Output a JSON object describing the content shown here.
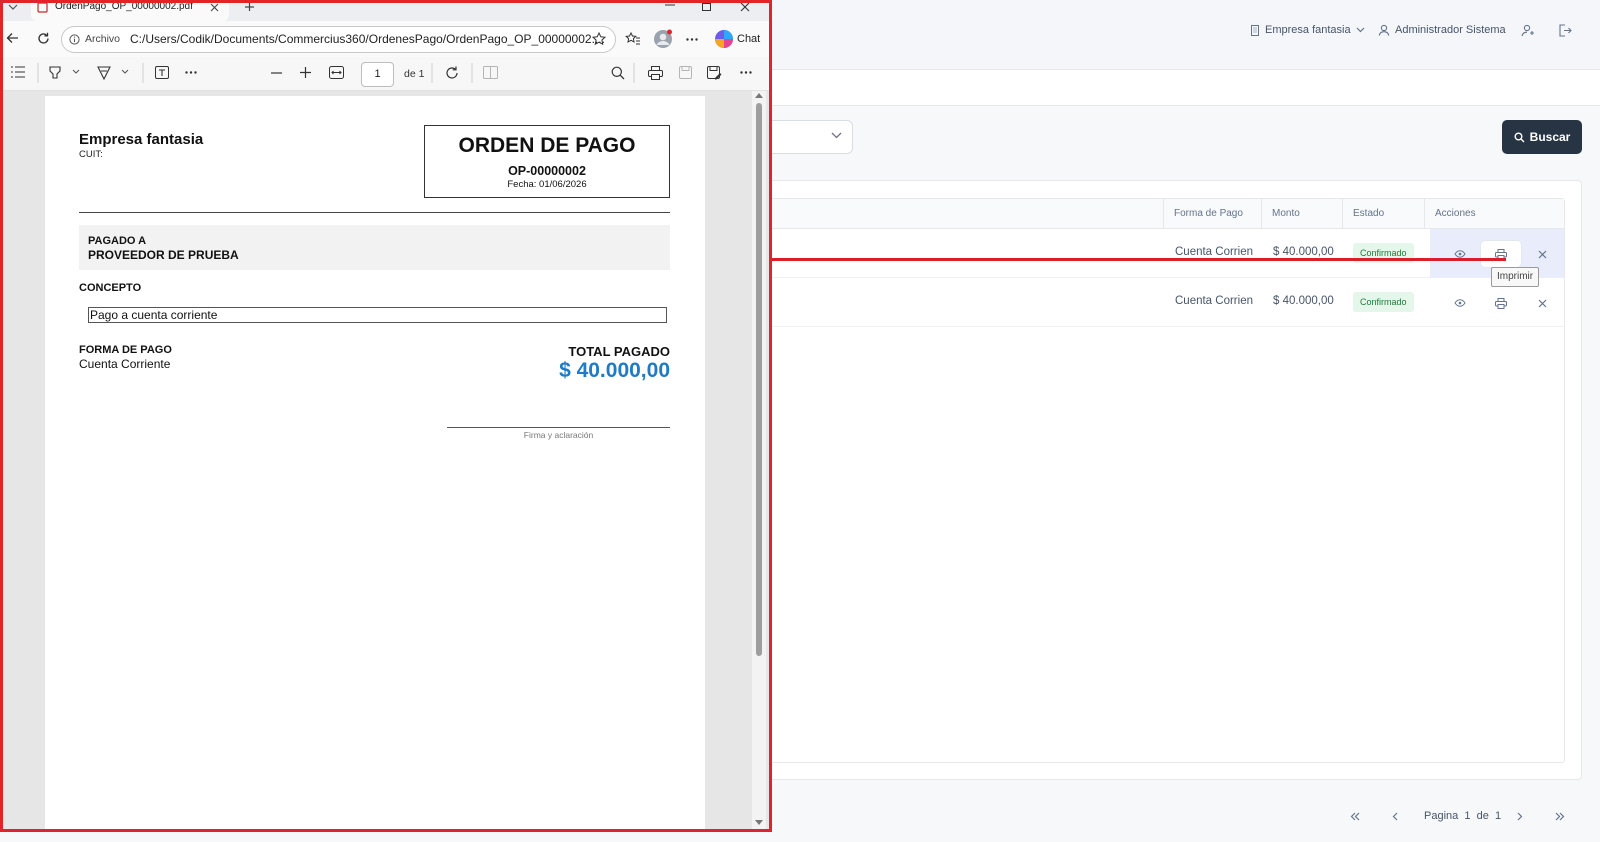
{
  "app": {
    "header": {
      "company_selector": "Empresa fantasia",
      "user_name": "Administrador Sistema"
    },
    "search_button": "Buscar",
    "table": {
      "columns": [
        "Forma de Pago",
        "Monto",
        "Estado",
        "Acciones"
      ],
      "rows": [
        {
          "forma_pago": "Cuenta Corrien",
          "monto": "$ 40.000,00",
          "estado": "Confirmado"
        },
        {
          "forma_pago": "Cuenta Corrien",
          "monto": "$ 40.000,00",
          "estado": "Confirmado"
        }
      ]
    },
    "tooltip": "Imprimir",
    "pagination": {
      "label": "Pagina",
      "current": "1",
      "of_label": "de",
      "total": "1"
    },
    "colors": {
      "primary_button": "#273444",
      "badge_bg": "#e5f6ea",
      "badge_text": "#1f7a3a",
      "highlight": "#d8202a"
    }
  },
  "browser": {
    "tab_title": "OrdenPago_OP_00000002.pdf",
    "address_label": "Archivo",
    "url": "C:/Users/Codik/Documents/Commercius360/OrdenesPago/OrdenPago_OP_00000002....",
    "chat_label": "Chat",
    "page_input": "1",
    "page_of": "de 1"
  },
  "document": {
    "company": "Empresa fantasia",
    "cuit_label": "CUIT:",
    "title": "ORDEN DE PAGO",
    "number": "OP-00000002",
    "date": "Fecha: 01/06/2026",
    "paid_to_label": "PAGADO A",
    "paid_to": "PROVEEDOR DE PRUEBA",
    "concept_label": "CONCEPTO",
    "concept": "Pago a cuenta corriente",
    "payment_method_label": "FORMA DE PAGO",
    "payment_method": "Cuenta Corriente",
    "total_label": "TOTAL PAGADO",
    "total": "$ 40.000,00",
    "signature_label": "Firma y aclaración",
    "total_color": "#1f7bc6"
  }
}
